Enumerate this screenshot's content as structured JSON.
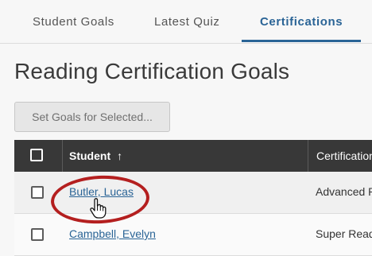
{
  "tabs": [
    {
      "label": "Student Goals"
    },
    {
      "label": "Latest Quiz"
    },
    {
      "label": "Certifications"
    }
  ],
  "page_title": "Reading Certification Goals",
  "set_goals_button": "Set Goals for Selected...",
  "table": {
    "headers": {
      "student": "Student",
      "sort_arrow": "↑",
      "certification": "Certification"
    },
    "rows": [
      {
        "student": "Butler, Lucas",
        "certification": "Advanced R"
      },
      {
        "student": "Campbell, Evelyn",
        "certification": "Super Read"
      }
    ]
  },
  "colors": {
    "accent": "#2a6496",
    "header_bg": "#383838",
    "annotation": "#b41f1f"
  }
}
